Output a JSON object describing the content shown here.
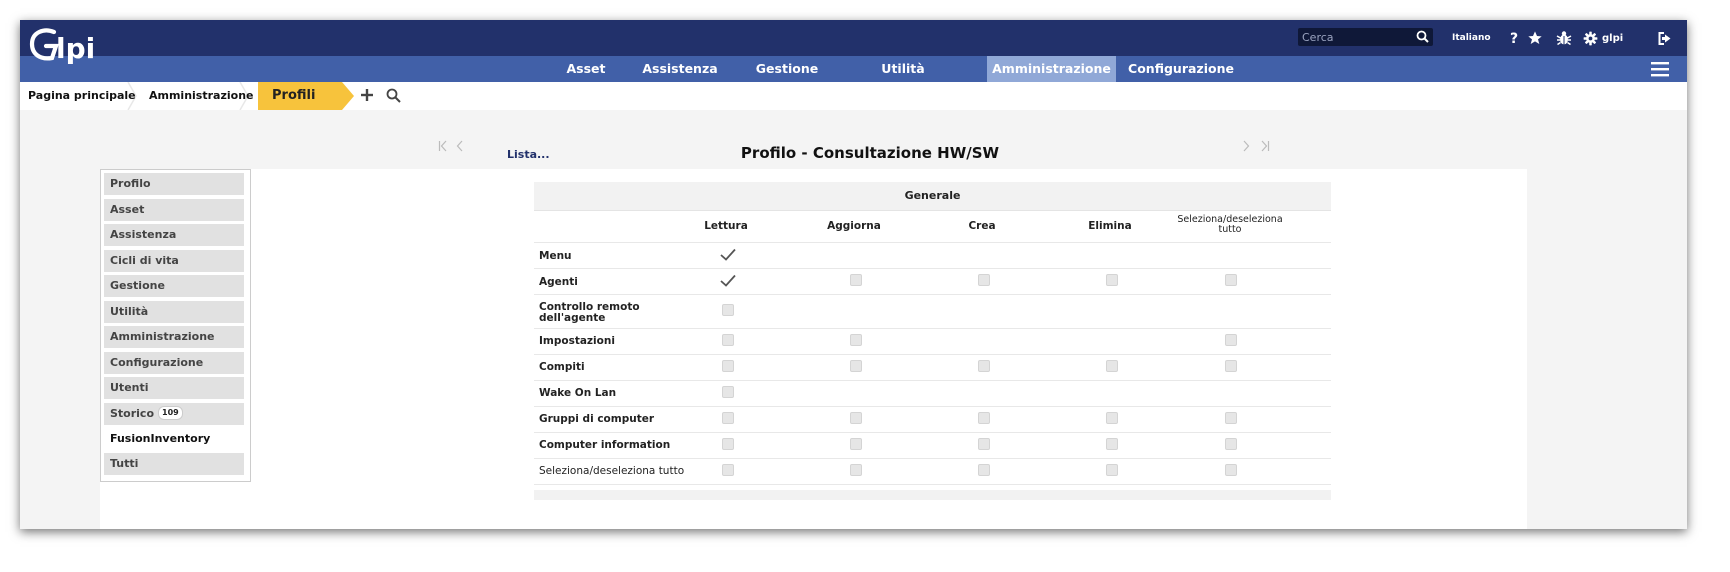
{
  "header": {
    "logo_text": "Glpi",
    "search_placeholder": "Cerca",
    "language": "Italiano",
    "user": "glpi",
    "icons": [
      "question-icon",
      "star-icon",
      "bug-icon",
      "gear-icon",
      "logout-icon"
    ]
  },
  "nav": {
    "items": [
      "Asset",
      "Assistenza",
      "Gestione",
      "Utilità",
      "Amministrazione",
      "Configurazione"
    ],
    "active": "Amministrazione",
    "active_color": "#90a8d7"
  },
  "breadcrumb": {
    "items": [
      "Pagina principale",
      "Amministrazione"
    ],
    "current": "Profili",
    "current_color": "#f7c33c"
  },
  "page": {
    "list_link": "Lista...",
    "title": "Profilo - Consultazione HW/SW"
  },
  "tabs": {
    "items": [
      "Profilo",
      "Asset",
      "Assistenza",
      "Cicli di vita",
      "Gestione",
      "Utilità",
      "Amministrazione",
      "Configurazione",
      "Utenti",
      "Storico",
      "FusionInventory",
      "Tutti"
    ],
    "storico_count": "109",
    "active": "FusionInventory"
  },
  "table": {
    "section_title": "Generale",
    "columns": [
      "Lettura",
      "Aggiorna",
      "Crea",
      "Elimina",
      "Seleziona/deseleziona tutto"
    ],
    "rows": [
      {
        "label": "Menu",
        "cells": [
          "checked",
          "",
          "",
          "",
          ""
        ]
      },
      {
        "label": "Agenti",
        "cells": [
          "checked",
          "box",
          "box",
          "box",
          "box"
        ]
      },
      {
        "label": "Controllo remoto dell'agente",
        "cells": [
          "box",
          "",
          "",
          "",
          ""
        ]
      },
      {
        "label": "Impostazioni",
        "cells": [
          "box",
          "box",
          "",
          "",
          "box"
        ]
      },
      {
        "label": "Compiti",
        "cells": [
          "box",
          "box",
          "box",
          "box",
          "box"
        ]
      },
      {
        "label": "Wake On Lan",
        "cells": [
          "box",
          "",
          "",
          "",
          ""
        ]
      },
      {
        "label": "Gruppi di computer",
        "cells": [
          "box",
          "box",
          "box",
          "box",
          "box"
        ]
      },
      {
        "label": "Computer information",
        "cells": [
          "box",
          "box",
          "box",
          "box",
          "box"
        ]
      },
      {
        "label": "Seleziona/deseleziona tutto",
        "cells": [
          "box",
          "box",
          "box",
          "box",
          "box"
        ]
      }
    ]
  },
  "colors": {
    "topbar": "#22316b",
    "mainbar": "#4160a8"
  }
}
